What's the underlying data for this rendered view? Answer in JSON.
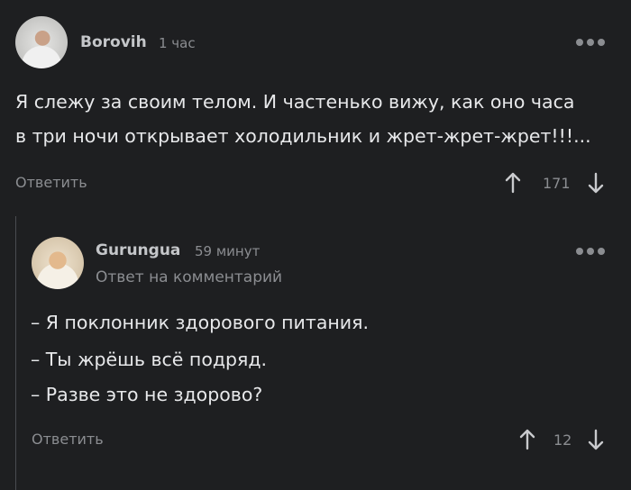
{
  "comment": {
    "username": "Borovih",
    "time": "1 час",
    "lines": [
      "Я слежу за своим телом. И частенько вижу, как оно часа",
      "в три ночи открывает холодильник и жрет-жрет-жрет!!!..."
    ],
    "reply_label": "Ответить",
    "rating": "171"
  },
  "reply": {
    "username": "Gurungua",
    "time": "59 минут",
    "reply_to": "Ответ на комментарий",
    "lines": [
      "– Я поклонник здорового питания.",
      "– Ты жрёшь всё подряд.",
      "– Разве это не здорово?"
    ],
    "reply_label": "Ответить",
    "rating": "12"
  },
  "icons": {
    "more": "more-dots-icon",
    "upvote": "arrow-up-icon",
    "downvote": "arrow-down-icon"
  },
  "colors": {
    "background": "#1e1f21",
    "text": "#e7e8ea",
    "muted": "#8b8d91"
  }
}
